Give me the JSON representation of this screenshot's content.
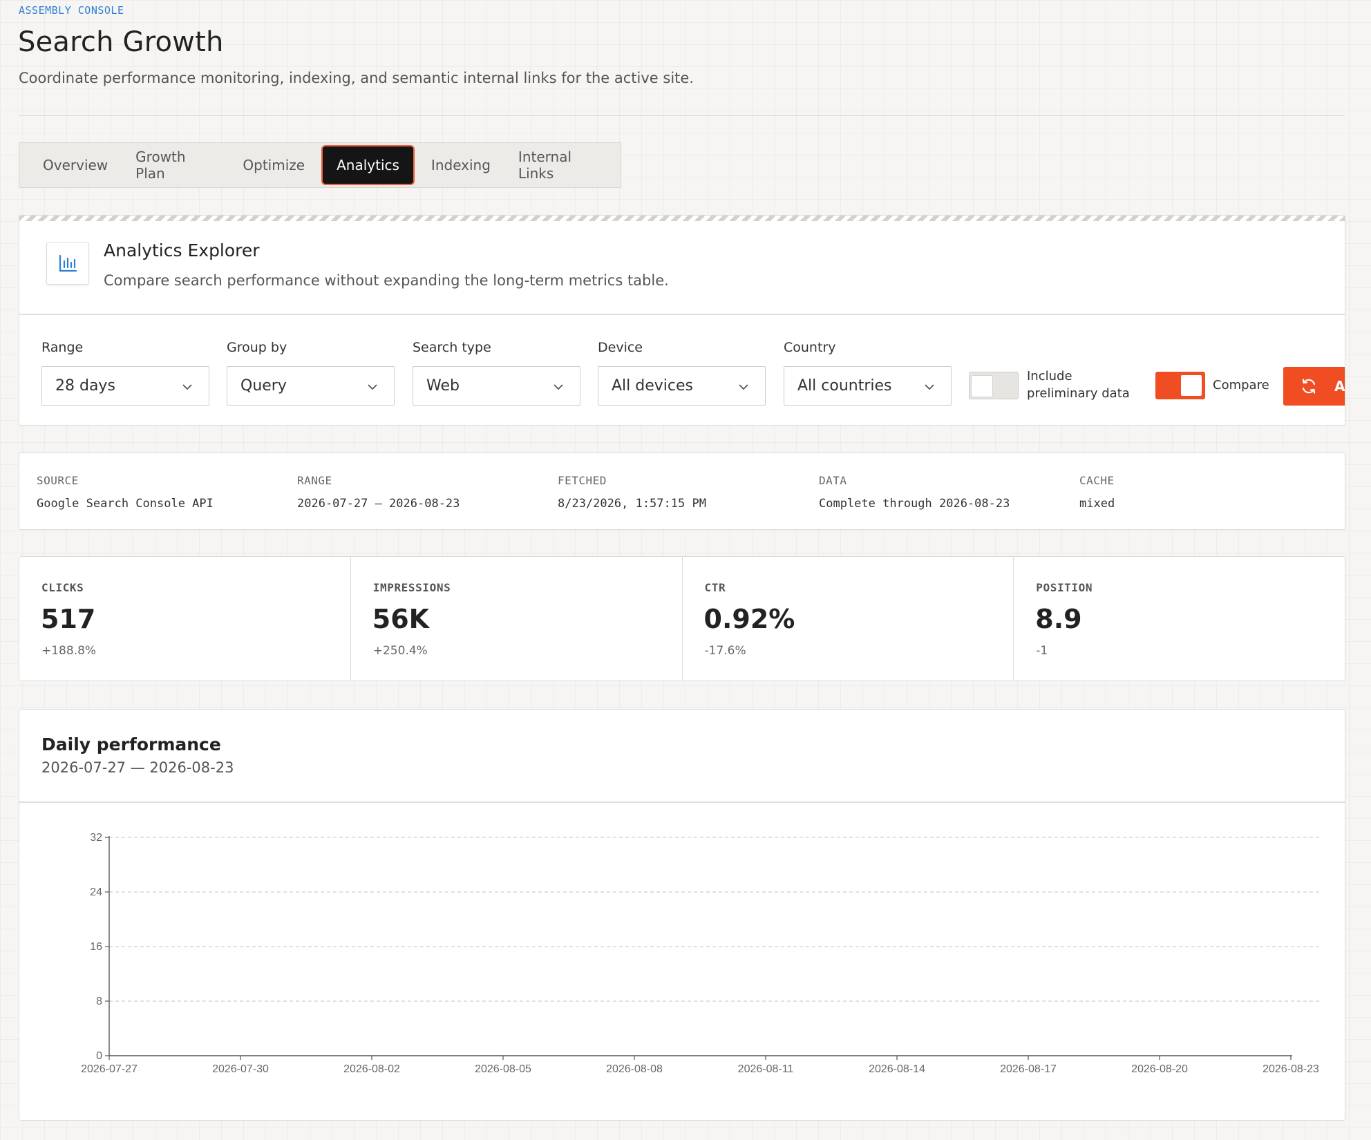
{
  "header": {
    "eyebrow": "ASSEMBLY CONSOLE",
    "title": "Search Growth",
    "subtitle": "Coordinate performance monitoring, indexing, and semantic internal links for the active site."
  },
  "tabs": [
    {
      "label": "Overview",
      "active": false
    },
    {
      "label": "Growth Plan",
      "active": false
    },
    {
      "label": "Optimize",
      "active": false
    },
    {
      "label": "Analytics",
      "active": true
    },
    {
      "label": "Indexing",
      "active": false
    },
    {
      "label": "Internal Links",
      "active": false
    }
  ],
  "explorer": {
    "icon": "bar-chart-icon",
    "title": "Analytics Explorer",
    "description": "Compare search performance without expanding the long-term metrics table.",
    "filters": {
      "range": {
        "label": "Range",
        "value": "28 days"
      },
      "group_by": {
        "label": "Group by",
        "value": "Query"
      },
      "search_type": {
        "label": "Search type",
        "value": "Web"
      },
      "device": {
        "label": "Device",
        "value": "All devices"
      },
      "country": {
        "label": "Country",
        "value": "All countries"
      }
    },
    "preliminary": {
      "label_line1": "Include",
      "label_line2": "preliminary data",
      "enabled": false
    },
    "compare": {
      "label": "Compare",
      "enabled": true
    },
    "apply_button": {
      "label": "Ap",
      "icon": "refresh-icon"
    }
  },
  "meta": [
    {
      "label": "SOURCE",
      "value": "Google Search Console API"
    },
    {
      "label": "RANGE",
      "value": "2026-07-27 – 2026-08-23"
    },
    {
      "label": "FETCHED",
      "value": "8/23/2026, 1:57:15 PM"
    },
    {
      "label": "DATA",
      "value": "Complete through 2026-08-23"
    },
    {
      "label": "CACHE",
      "value": "mixed"
    }
  ],
  "kpis": [
    {
      "label": "CLICKS",
      "value": "517",
      "delta": "+188.8%"
    },
    {
      "label": "IMPRESSIONS",
      "value": "56K",
      "delta": "+250.4%"
    },
    {
      "label": "CTR",
      "value": "0.92%",
      "delta": "-17.6%"
    },
    {
      "label": "POSITION",
      "value": "8.9",
      "delta": "-1"
    }
  ],
  "chart": {
    "title": "Daily performance",
    "range": "2026-07-27 — 2026-08-23"
  },
  "colors": {
    "accent": "#f04d23",
    "link": "#2f7fd6",
    "active_tab": "#151515"
  },
  "chart_data": {
    "type": "line",
    "title": "Daily performance",
    "subtitle": "2026-07-27 — 2026-08-23",
    "x_ticks": [
      "2026-07-27",
      "2026-07-30",
      "2026-08-02",
      "2026-08-05",
      "2026-08-08",
      "2026-08-11",
      "2026-08-14",
      "2026-08-17",
      "2026-08-20",
      "2026-08-23"
    ],
    "y_ticks": [
      0,
      8,
      16,
      24,
      32
    ],
    "ylim": [
      0,
      32
    ],
    "xlim": [
      "2026-07-27",
      "2026-08-23"
    ],
    "grid": "horizontal dashed",
    "series": []
  }
}
